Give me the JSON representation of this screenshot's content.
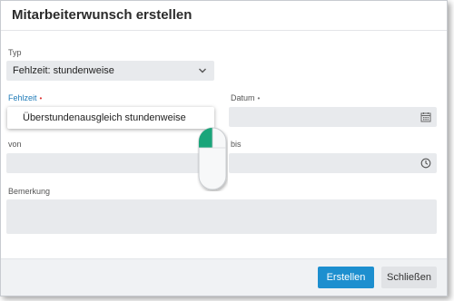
{
  "dialog": {
    "title": "Mitarbeiterwunsch erstellen"
  },
  "form": {
    "typ": {
      "label": "Typ",
      "value": "Fehlzeit: stundenweise",
      "icon": "chevron-down-icon"
    },
    "fehlzeit": {
      "label": "Fehlzeit",
      "required_marker": "•",
      "dropdown_option": "Überstundenausgleich stundenweise"
    },
    "datum": {
      "label": "Datum",
      "required_marker": "•",
      "value": "",
      "icon": "calendar-icon"
    },
    "von": {
      "label": "von",
      "value": ""
    },
    "bis": {
      "label": "bis",
      "value": "",
      "icon": "clock-icon"
    },
    "bemerkung": {
      "label": "Bemerkung",
      "value": ""
    }
  },
  "footer": {
    "create_label": "Erstellen",
    "close_label": "Schließen"
  },
  "colors": {
    "accent": "#1e7ab8",
    "primary_button": "#1d8fcf",
    "field_bg": "#e8eaed",
    "required": "#dd3333",
    "mouse_accent": "#1aa57a"
  }
}
